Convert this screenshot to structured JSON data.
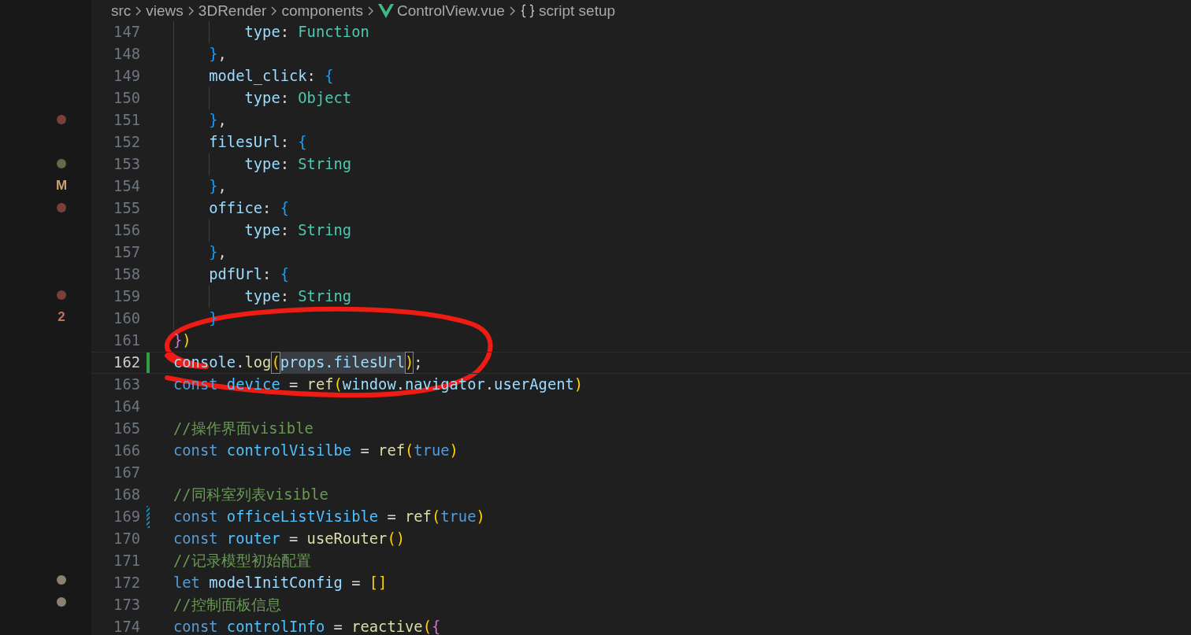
{
  "breadcrumb": [
    {
      "kind": "folder",
      "label": "src"
    },
    {
      "kind": "folder",
      "label": "views"
    },
    {
      "kind": "folder",
      "label": "3DRender"
    },
    {
      "kind": "folder",
      "label": "components"
    },
    {
      "kind": "file",
      "label": "ControlView.vue"
    },
    {
      "kind": "symbol",
      "label": "script setup"
    }
  ],
  "lines": [
    {
      "number": "147",
      "current": false,
      "tokens": [
        {
          "text": "        type",
          "kind": "var"
        },
        {
          "text": ": ",
          "kind": "punct"
        },
        {
          "text": "Function",
          "kind": "type"
        }
      ]
    },
    {
      "number": "148",
      "current": false,
      "tokens": [
        {
          "text": "    }",
          "kind": "b3"
        },
        {
          "text": ",",
          "kind": "punct"
        }
      ]
    },
    {
      "number": "149",
      "current": false,
      "tokens": [
        {
          "text": "    model_click",
          "kind": "var"
        },
        {
          "text": ": ",
          "kind": "punct"
        },
        {
          "text": "{",
          "kind": "b3"
        }
      ]
    },
    {
      "number": "150",
      "current": false,
      "tokens": [
        {
          "text": "        type",
          "kind": "var"
        },
        {
          "text": ": ",
          "kind": "punct"
        },
        {
          "text": "Object",
          "kind": "type"
        }
      ]
    },
    {
      "number": "151",
      "current": false,
      "marker": {
        "kind": "dot",
        "color": "#7a3f38"
      },
      "tokens": [
        {
          "text": "    }",
          "kind": "b3"
        },
        {
          "text": ",",
          "kind": "punct"
        }
      ]
    },
    {
      "number": "152",
      "current": false,
      "tokens": [
        {
          "text": "    filesUrl",
          "kind": "var"
        },
        {
          "text": ": ",
          "kind": "punct"
        },
        {
          "text": "{",
          "kind": "b3"
        }
      ]
    },
    {
      "number": "153",
      "current": false,
      "marker": {
        "kind": "dot",
        "color": "#6b6748"
      },
      "tokens": [
        {
          "text": "        type",
          "kind": "var"
        },
        {
          "text": ": ",
          "kind": "punct"
        },
        {
          "text": "String",
          "kind": "type"
        }
      ]
    },
    {
      "number": "154",
      "current": false,
      "marker": {
        "kind": "text",
        "text": "M",
        "color": "#c9a26d"
      },
      "tokens": [
        {
          "text": "    }",
          "kind": "b3"
        },
        {
          "text": ",",
          "kind": "punct"
        }
      ]
    },
    {
      "number": "155",
      "current": false,
      "marker": {
        "kind": "dot",
        "color": "#7a3f38"
      },
      "tokens": [
        {
          "text": "    office",
          "kind": "var"
        },
        {
          "text": ": ",
          "kind": "punct"
        },
        {
          "text": "{",
          "kind": "b3"
        }
      ]
    },
    {
      "number": "156",
      "current": false,
      "tokens": [
        {
          "text": "        type",
          "kind": "var"
        },
        {
          "text": ": ",
          "kind": "punct"
        },
        {
          "text": "String",
          "kind": "type"
        }
      ]
    },
    {
      "number": "157",
      "current": false,
      "tokens": [
        {
          "text": "    }",
          "kind": "b3"
        },
        {
          "text": ",",
          "kind": "punct"
        }
      ]
    },
    {
      "number": "158",
      "current": false,
      "tokens": [
        {
          "text": "    pdfUrl",
          "kind": "var"
        },
        {
          "text": ": ",
          "kind": "punct"
        },
        {
          "text": "{",
          "kind": "b3"
        }
      ]
    },
    {
      "number": "159",
      "current": false,
      "marker": {
        "kind": "dot",
        "color": "#7a3f38"
      },
      "tokens": [
        {
          "text": "        type",
          "kind": "var"
        },
        {
          "text": ": ",
          "kind": "punct"
        },
        {
          "text": "String",
          "kind": "type"
        }
      ]
    },
    {
      "number": "160",
      "current": false,
      "marker": {
        "kind": "text",
        "text": "2",
        "color": "#c5705c"
      },
      "tokens": [
        {
          "text": "    }",
          "kind": "b3"
        }
      ]
    },
    {
      "number": "161",
      "current": false,
      "tokens": [
        {
          "text": "}",
          "kind": "b2"
        },
        {
          "text": ")",
          "kind": "b1"
        }
      ]
    },
    {
      "number": "162",
      "current": true,
      "change": {
        "kind": "added"
      },
      "tokens": [
        {
          "text": "console",
          "kind": "var"
        },
        {
          "text": ".",
          "kind": "punct"
        },
        {
          "text": "log",
          "kind": "fn"
        },
        {
          "text": "(",
          "kind": "b1",
          "matched": true
        },
        {
          "text": "props.filesUrl",
          "kind": "var",
          "highlighted": true
        },
        {
          "text": ")",
          "kind": "b1",
          "matched": true
        },
        {
          "text": ";",
          "kind": "punct"
        }
      ]
    },
    {
      "number": "163",
      "current": false,
      "tokens": [
        {
          "text": "const ",
          "kind": "kw"
        },
        {
          "text": "device",
          "kind": "const"
        },
        {
          "text": " = ",
          "kind": "punct"
        },
        {
          "text": "ref",
          "kind": "fn"
        },
        {
          "text": "(",
          "kind": "b1"
        },
        {
          "text": "window",
          "kind": "var"
        },
        {
          "text": ".",
          "kind": "punct"
        },
        {
          "text": "navigator",
          "kind": "var"
        },
        {
          "text": ".",
          "kind": "punct"
        },
        {
          "text": "userAgent",
          "kind": "var"
        },
        {
          "text": ")",
          "kind": "b1"
        }
      ]
    },
    {
      "number": "164",
      "current": false
    },
    {
      "number": "165",
      "current": false,
      "tokens": [
        {
          "text": "//操作界面visible",
          "kind": "comment"
        }
      ]
    },
    {
      "number": "166",
      "current": false,
      "tokens": [
        {
          "text": "const ",
          "kind": "kw"
        },
        {
          "text": "controlVisilbe",
          "kind": "const"
        },
        {
          "text": " = ",
          "kind": "punct"
        },
        {
          "text": "ref",
          "kind": "fn"
        },
        {
          "text": "(",
          "kind": "b1"
        },
        {
          "text": "true",
          "kind": "kw"
        },
        {
          "text": ")",
          "kind": "b1"
        }
      ]
    },
    {
      "number": "167",
      "current": false
    },
    {
      "number": "168",
      "current": false,
      "tokens": [
        {
          "text": "//同科室列表visible",
          "kind": "comment"
        }
      ]
    },
    {
      "number": "169",
      "current": false,
      "change": {
        "kind": "modified"
      },
      "tokens": [
        {
          "text": "const ",
          "kind": "kw"
        },
        {
          "text": "officeListVisible",
          "kind": "const"
        },
        {
          "text": " = ",
          "kind": "punct"
        },
        {
          "text": "ref",
          "kind": "fn"
        },
        {
          "text": "(",
          "kind": "b1"
        },
        {
          "text": "true",
          "kind": "kw"
        },
        {
          "text": ")",
          "kind": "b1"
        }
      ]
    },
    {
      "number": "170",
      "current": false,
      "tokens": [
        {
          "text": "const ",
          "kind": "kw"
        },
        {
          "text": "router",
          "kind": "const"
        },
        {
          "text": " = ",
          "kind": "punct"
        },
        {
          "text": "useRouter",
          "kind": "fn"
        },
        {
          "text": "()",
          "kind": "b1"
        }
      ]
    },
    {
      "number": "171",
      "current": false,
      "tokens": [
        {
          "text": "//记录模型初始配置",
          "kind": "comment"
        }
      ]
    },
    {
      "number": "172",
      "current": false,
      "marker": {
        "kind": "dot",
        "color": "#8a8172"
      },
      "tokens": [
        {
          "text": "let ",
          "kind": "kw"
        },
        {
          "text": "modelInitConfig",
          "kind": "var"
        },
        {
          "text": " = ",
          "kind": "punct"
        },
        {
          "text": "[]",
          "kind": "b1"
        }
      ]
    },
    {
      "number": "173",
      "current": false,
      "marker": {
        "kind": "dot",
        "color": "#8a8172"
      },
      "tokens": [
        {
          "text": "//控制面板信息",
          "kind": "comment"
        }
      ]
    },
    {
      "number": "174",
      "current": false,
      "tokens": [
        {
          "text": "const ",
          "kind": "kw"
        },
        {
          "text": "controlInfo",
          "kind": "const"
        },
        {
          "text": " = ",
          "kind": "punct"
        },
        {
          "text": "reactive",
          "kind": "fn"
        },
        {
          "text": "(",
          "kind": "b1"
        },
        {
          "text": "{",
          "kind": "b2"
        }
      ]
    }
  ]
}
